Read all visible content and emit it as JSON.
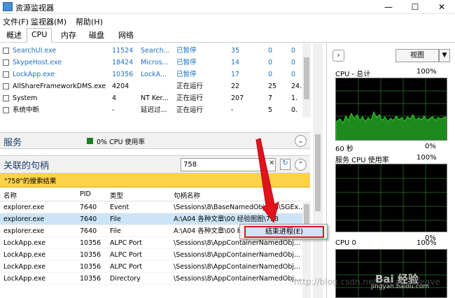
{
  "window": {
    "title": "资源监视器",
    "min": "—",
    "max": "☐",
    "close": "✕"
  },
  "menu": [
    "文件(F)",
    "监视器(M)",
    "帮助(H)"
  ],
  "tabs": [
    "概述",
    "CPU",
    "内存",
    "磁盘",
    "网络"
  ],
  "processes": [
    {
      "name": "SearchUI.exe",
      "pid": "11524",
      "desc": "Search...",
      "status": "已暂停",
      "threads": "35",
      "cpu": "0",
      "avg": "0",
      "blue": true
    },
    {
      "name": "SkypeHost.exe",
      "pid": "18424",
      "desc": "Micros...",
      "status": "已暂停",
      "threads": "14",
      "cpu": "0",
      "avg": "0",
      "blue": true
    },
    {
      "name": "LockApp.exe",
      "pid": "10356",
      "desc": "LockA...",
      "status": "已暂停",
      "threads": "17",
      "cpu": "0",
      "avg": "0",
      "blue": true
    },
    {
      "name": "AllShareFrameworkDMS.exe",
      "pid": "4204",
      "desc": "",
      "status": "正在运行",
      "threads": "22",
      "cpu": "25",
      "avg": "24.",
      "blue": false
    },
    {
      "name": "System",
      "pid": "4",
      "desc": "NT Ker...",
      "status": "正在运行",
      "threads": "207",
      "cpu": "7",
      "avg": "1.",
      "blue": false
    },
    {
      "name": "系统中断",
      "pid": "-",
      "desc": "延迟过...",
      "status": "正在运行",
      "threads": "-",
      "cpu": "5",
      "avg": "0.",
      "blue": false
    }
  ],
  "services": {
    "title": "服务",
    "summary": "0% CPU 使用率"
  },
  "handles": {
    "title": "关联的句柄",
    "search_value": "758",
    "result_text": "\"758\"的搜索结果",
    "columns": [
      "名称",
      "PID",
      "类型",
      "句柄名称"
    ],
    "rows": [
      {
        "name": "explorer.exe",
        "pid": "7640",
        "type": "Event",
        "handle": "\\Sessions\\8\\BaseNamedObjects\\SGEx..."
      },
      {
        "name": "explorer.exe",
        "pid": "7640",
        "type": "File",
        "handle": "A:\\A04 各种文章\\00 经验图图\\758"
      },
      {
        "name": "explorer.exe",
        "pid": "7640",
        "type": "File",
        "handle": "A:\\A04 各种文章\\00 经验图图\\758"
      },
      {
        "name": "LockApp.exe",
        "pid": "10356",
        "type": "ALPC Port",
        "handle": "\\Sessions\\8\\AppContainerNamedObj..."
      },
      {
        "name": "LockApp.exe",
        "pid": "10356",
        "type": "ALPC Port",
        "handle": "\\Sessions\\8\\AppContainerNamedObj..."
      },
      {
        "name": "LockApp.exe",
        "pid": "10356",
        "type": "ALPC Port",
        "handle": "\\Sessions\\8\\AppContainerNamedObj..."
      },
      {
        "name": "LockApp.exe",
        "pid": "10356",
        "type": "Directory",
        "handle": "\\Sessions\\8\\AppContainerNamedObj..."
      }
    ]
  },
  "context_menu": {
    "end_process": "结束进程(E)"
  },
  "right": {
    "view_button": "视图",
    "cpu_total": "CPU - 总计",
    "cpu_total_pct": "100%",
    "time_label": "60 秒",
    "zero": "0%",
    "service_cpu": "服务 CPU 使用率",
    "service_cpu_pct": "100%",
    "cpu0": "CPU 0",
    "cpu0_pct": "100%"
  },
  "watermark": {
    "baidu": "Bai 经验",
    "url": "jingyan.baidu.com",
    "blog": "http://blog.csdn.net/Dream_Weave"
  },
  "colors": {
    "graph_green": "#2aaa2a",
    "highlight": "#ffd24a",
    "selection": "#cce4f7",
    "arrow": "#e1131d"
  }
}
